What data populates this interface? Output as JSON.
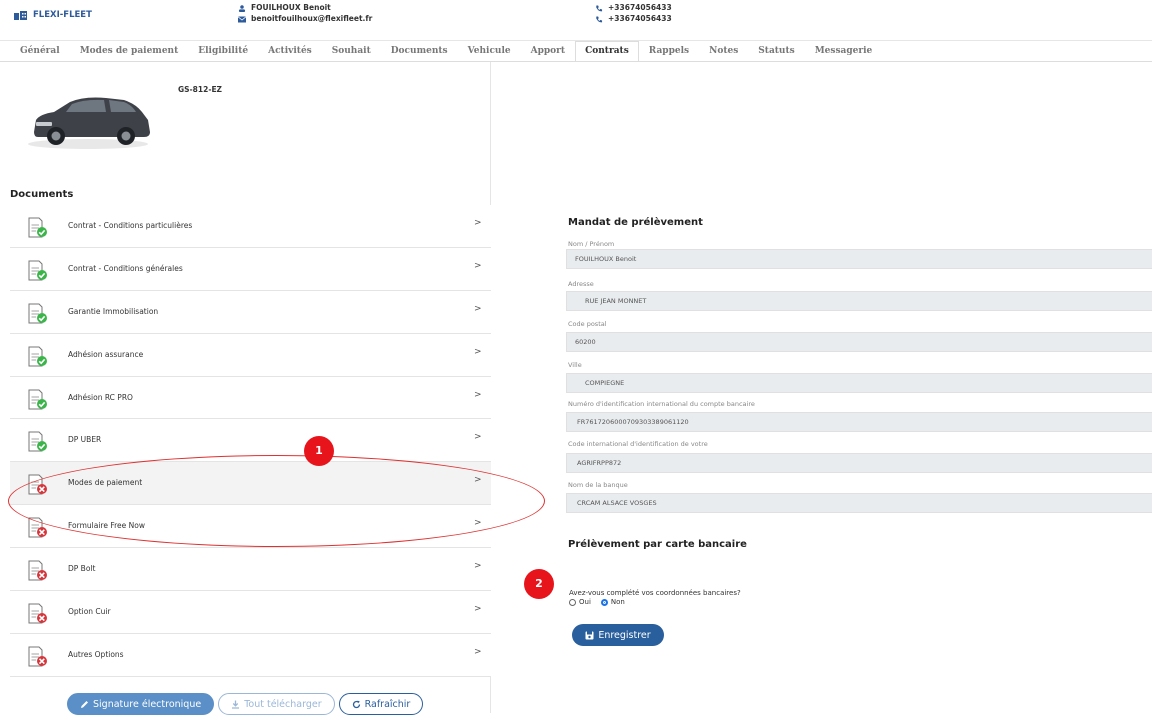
{
  "header": {
    "brand": "FLEXI-FLEET",
    "user_name": "FOUILHOUX Benoit",
    "user_email": "benoitfouilhoux@flexifleet.fr",
    "phone_1": "+33674056433",
    "phone_2": "+33674056433"
  },
  "tabs": [
    {
      "label": "Général"
    },
    {
      "label": "Modes de paiement"
    },
    {
      "label": "Eligibilité"
    },
    {
      "label": "Activités"
    },
    {
      "label": "Souhait"
    },
    {
      "label": "Documents"
    },
    {
      "label": "Vehicule"
    },
    {
      "label": "Apport"
    },
    {
      "label": "Contrats",
      "active": true
    },
    {
      "label": "Rappels"
    },
    {
      "label": "Notes"
    },
    {
      "label": "Statuts"
    },
    {
      "label": "Messagerie"
    }
  ],
  "vehicle": {
    "plate": "GS-812-EZ"
  },
  "documents": {
    "title": "Documents",
    "items": [
      {
        "label": "Contrat - Conditions particulières",
        "status": "ok"
      },
      {
        "label": "Contrat - Conditions générales",
        "status": "ok"
      },
      {
        "label": "Garantie Immobilisation",
        "status": "ok"
      },
      {
        "label": "Adhésion assurance",
        "status": "ok"
      },
      {
        "label": "Adhésion RC PRO",
        "status": "ok"
      },
      {
        "label": "DP UBER",
        "status": "ok"
      },
      {
        "label": "Modes de paiement",
        "status": "missing"
      },
      {
        "label": "Formulaire Free Now",
        "status": "missing"
      },
      {
        "label": "DP Bolt",
        "status": "missing"
      },
      {
        "label": "Option Cuir",
        "status": "missing"
      },
      {
        "label": "Autres Options",
        "status": "missing"
      }
    ],
    "arrow": ">"
  },
  "buttons": {
    "signature": "Signature électronique",
    "download_all": "Tout télécharger",
    "refresh": "Rafraîchir"
  },
  "mandat": {
    "title": "Mandat de prélèvement",
    "fields": [
      {
        "label": "Nom / Prénom",
        "value": "FOUILHOUX Benoit"
      },
      {
        "label": "Adresse",
        "value": "RUE JEAN MONNET"
      },
      {
        "label": "Code postal",
        "value": "60200"
      },
      {
        "label": "Ville",
        "value": "COMPIEGNE"
      },
      {
        "label": "Numéro d'identification international du compte bancaire",
        "value": "FR7617206000709303389061120"
      },
      {
        "label": "Code international d'identification de votre",
        "value": "AGRIFRPP872"
      },
      {
        "label": "Nom de la banque",
        "value": "CRCAM ALSACE VOSGES"
      }
    ]
  },
  "carte": {
    "title": "Prélèvement par carte bancaire",
    "question": "Avez-vous complété vos coordonnées bancaires?",
    "option_yes": "Oui",
    "option_no": "Non",
    "selected": "Non",
    "save": "Enregistrer"
  },
  "annotations": {
    "badge_1": "1",
    "badge_2": "2"
  },
  "colors": {
    "ok": "#3bb54a",
    "missing": "#d6353a",
    "primary": "#2a5f9e",
    "annotation": "#e8141b"
  }
}
